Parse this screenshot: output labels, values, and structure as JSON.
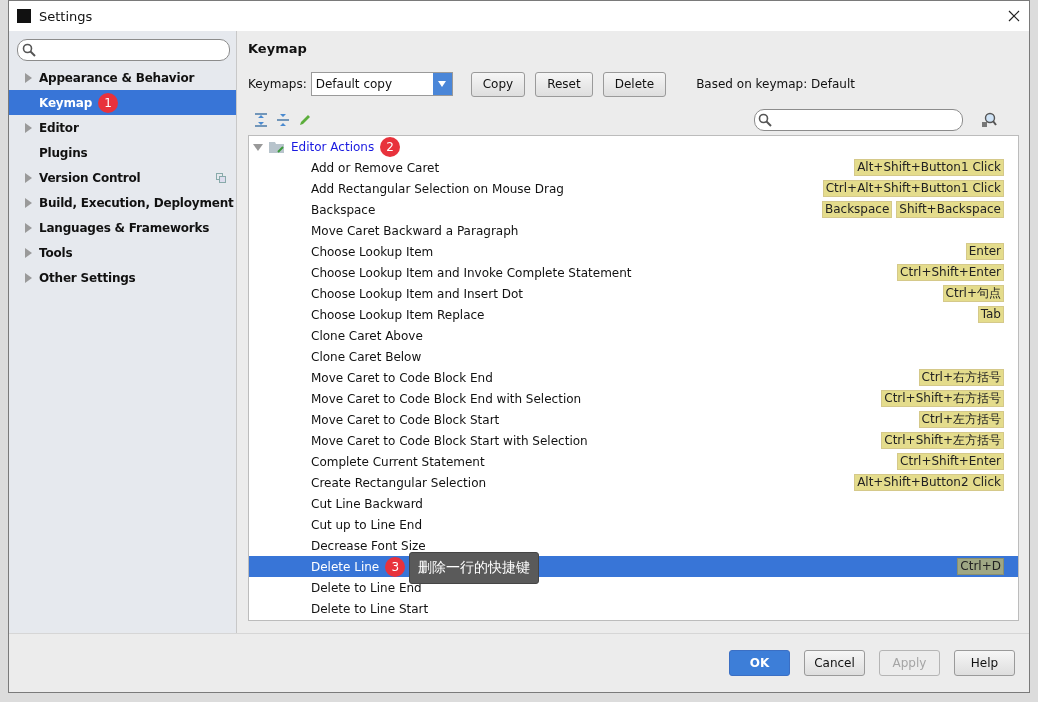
{
  "window": {
    "title": "Settings"
  },
  "sidebar": {
    "items": [
      {
        "label": "Appearance & Behavior",
        "expandable": true,
        "selected": false,
        "has_icon": false
      },
      {
        "label": "Keymap",
        "expandable": false,
        "selected": true,
        "badge": "1",
        "has_icon": false
      },
      {
        "label": "Editor",
        "expandable": true,
        "selected": false,
        "has_icon": false
      },
      {
        "label": "Plugins",
        "expandable": false,
        "selected": false,
        "has_icon": false
      },
      {
        "label": "Version Control",
        "expandable": true,
        "selected": false,
        "has_icon": true
      },
      {
        "label": "Build, Execution, Deployment",
        "expandable": true,
        "selected": false,
        "has_icon": false
      },
      {
        "label": "Languages & Frameworks",
        "expandable": true,
        "selected": false,
        "has_icon": false
      },
      {
        "label": "Tools",
        "expandable": true,
        "selected": false,
        "has_icon": false
      },
      {
        "label": "Other Settings",
        "expandable": true,
        "selected": false,
        "has_icon": false
      }
    ]
  },
  "panel": {
    "title": "Keymap",
    "keymaps_label": "Keymaps:",
    "keymap_value": "Default copy",
    "buttons": [
      "Copy",
      "Reset",
      "Delete"
    ],
    "based_on": "Based on keymap: Default"
  },
  "tree": {
    "group": {
      "label": "Editor Actions",
      "expanded": true,
      "badge": "2"
    },
    "rows": [
      {
        "name": "Add or Remove Caret",
        "shortcuts": [
          "Alt+Shift+Button1 Click"
        ],
        "selected": false
      },
      {
        "name": "Add Rectangular Selection on Mouse Drag",
        "shortcuts": [
          "Ctrl+Alt+Shift+Button1 Click"
        ],
        "selected": false
      },
      {
        "name": "Backspace",
        "shortcuts": [
          "Backspace",
          "Shift+Backspace"
        ],
        "selected": false
      },
      {
        "name": "Move Caret Backward a Paragraph",
        "shortcuts": [],
        "selected": false
      },
      {
        "name": "Choose Lookup Item",
        "shortcuts": [
          "Enter"
        ],
        "selected": false
      },
      {
        "name": "Choose Lookup Item and Invoke Complete Statement",
        "shortcuts": [
          "Ctrl+Shift+Enter"
        ],
        "selected": false
      },
      {
        "name": "Choose Lookup Item and Insert Dot",
        "shortcuts": [
          "Ctrl+句点"
        ],
        "selected": false
      },
      {
        "name": "Choose Lookup Item Replace",
        "shortcuts": [
          "Tab"
        ],
        "selected": false
      },
      {
        "name": "Clone Caret Above",
        "shortcuts": [],
        "selected": false
      },
      {
        "name": "Clone Caret Below",
        "shortcuts": [],
        "selected": false
      },
      {
        "name": "Move Caret to Code Block End",
        "shortcuts": [
          "Ctrl+右方括号"
        ],
        "selected": false
      },
      {
        "name": "Move Caret to Code Block End with Selection",
        "shortcuts": [
          "Ctrl+Shift+右方括号"
        ],
        "selected": false
      },
      {
        "name": "Move Caret to Code Block Start",
        "shortcuts": [
          "Ctrl+左方括号"
        ],
        "selected": false
      },
      {
        "name": "Move Caret to Code Block Start with Selection",
        "shortcuts": [
          "Ctrl+Shift+左方括号"
        ],
        "selected": false
      },
      {
        "name": "Complete Current Statement",
        "shortcuts": [
          "Ctrl+Shift+Enter"
        ],
        "selected": false
      },
      {
        "name": "Create Rectangular Selection",
        "shortcuts": [
          "Alt+Shift+Button2 Click"
        ],
        "selected": false
      },
      {
        "name": "Cut Line Backward",
        "shortcuts": [],
        "selected": false
      },
      {
        "name": "Cut up to Line End",
        "shortcuts": [],
        "selected": false
      },
      {
        "name": "Decrease Font Size",
        "shortcuts": [],
        "selected": false
      },
      {
        "name": "Delete Line",
        "shortcuts": [
          "Ctrl+D"
        ],
        "selected": true,
        "badge": "3",
        "tooltip": "删除一行的快捷键"
      },
      {
        "name": "Delete to Line End",
        "shortcuts": [],
        "selected": false
      },
      {
        "name": "Delete to Line Start",
        "shortcuts": [],
        "selected": false
      }
    ]
  },
  "footer": {
    "buttons": [
      {
        "label": "OK",
        "kind": "primary",
        "disabled": false
      },
      {
        "label": "Cancel",
        "kind": "normal",
        "disabled": false
      },
      {
        "label": "Apply",
        "kind": "normal",
        "disabled": true
      },
      {
        "label": "Help",
        "kind": "normal",
        "disabled": false
      }
    ]
  }
}
